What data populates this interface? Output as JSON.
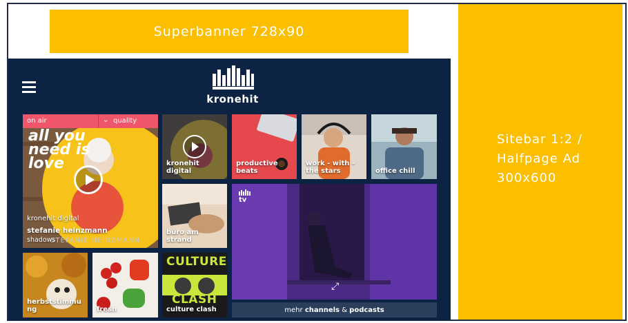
{
  "ads": {
    "superbanner": "Superbanner 728x90",
    "sitebar": "Sitebar 1:2 /\nHalfpage Ad\n300x600"
  },
  "brand": {
    "name": "kronehit"
  },
  "player": {
    "on_air": "on air",
    "quality": "quality",
    "channel": "kronehit digital",
    "artist": "stefanie heinzmann",
    "song": "shadows",
    "artwork_text": "all you need is love",
    "artwork_name": "STEFANIE HEINZMANN"
  },
  "tiles": [
    {
      "label": "kronehit\ndigital"
    },
    {
      "label": "productive\nbeats"
    },
    {
      "label": "work - with -\nthe stars"
    },
    {
      "label": "office chill"
    },
    {
      "label": "büro am\nstrand"
    },
    {
      "label": "herbststimmu\nng"
    },
    {
      "label": "fresh"
    },
    {
      "label": "culture clash"
    }
  ],
  "culture_art": {
    "top": "CULTURE",
    "bottom": "CLASH"
  },
  "tv": {
    "badge": "tv"
  },
  "more": {
    "prefix": "mehr ",
    "channels": "channels",
    "amp": " & ",
    "podcasts": "podcasts"
  },
  "colors": {
    "brand_navy": "#0d2344",
    "ad_yellow": "#fbbf00",
    "on_air_pink": "#f0566b"
  }
}
